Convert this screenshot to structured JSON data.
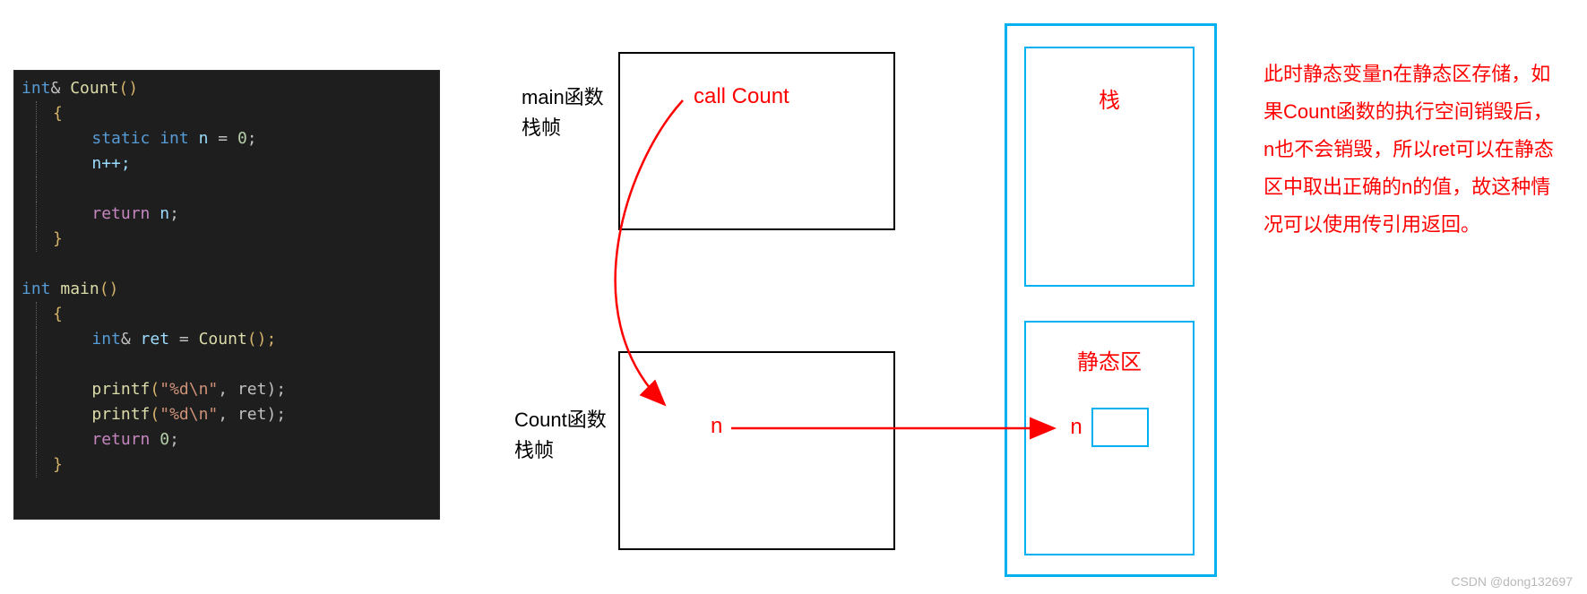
{
  "code": {
    "l1_kw": "int",
    "l1_amp": "&",
    "l1_fn": " Count",
    "l1_par": "()",
    "brace_open": "{",
    "brace_close": "}",
    "l3_kw": "static int",
    "l3_var": " n",
    "l3_eq": " = ",
    "l3_num": "0",
    "semi": ";",
    "l4_expr": "n++;",
    "l6_kw": "return",
    "l6_var": " n",
    "l9_kw": "int",
    "l9_fn": " main",
    "l9_par": "()",
    "l11_kw": "int",
    "l11_amp": "&",
    "l11_var": " ret",
    "l11_eq": " = ",
    "l11_call": "Count",
    "l11_par": "();",
    "lp_fn": "printf",
    "lp_par_open": "(",
    "lp_str": "\"%d\\n\"",
    "lp_mid": ", ret);",
    "lret_kw": "return",
    "lret_num": " 0"
  },
  "diagram": {
    "main_label_l1": "main函数",
    "main_label_l2": "栈帧",
    "count_label_l1": "Count函数",
    "count_label_l2": "栈帧",
    "call_label": "call Count",
    "n_label": "n"
  },
  "memory": {
    "stack": "栈",
    "static": "静态区",
    "n": "n"
  },
  "explain_text": "此时静态变量n在静态区存储，如果Count函数的执行空间销毁后，n也不会销毁，所以ret可以在静态区中取出正确的n的值，故这种情况可以使用传引用返回。",
  "watermark": "CSDN @dong132697"
}
